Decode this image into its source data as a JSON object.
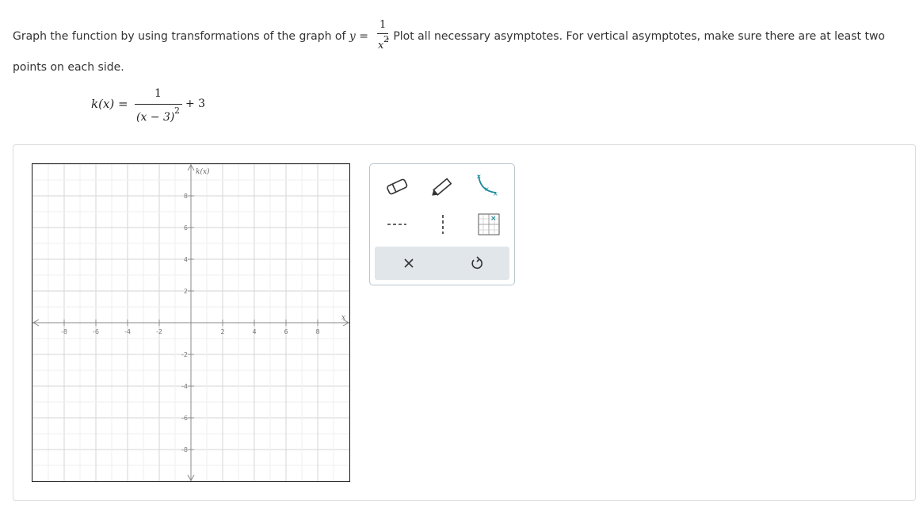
{
  "prompt": {
    "text_before": "Graph the function by using transformations of the graph of ",
    "y_var": "y",
    "equals": "=",
    "base_numerator": "1",
    "base_denominator": "x",
    "base_exponent": "2",
    "text_after": ". Plot all necessary asymptotes. For vertical asymptotes, make sure there are at least two",
    "text_line2": "points on each side."
  },
  "function": {
    "lhs": "k(x) =",
    "numerator": "1",
    "denominator": "(x − 3)",
    "exponent": "2",
    "shift": "+ 3"
  },
  "graph": {
    "y_axis_label": "k(x)",
    "x_axis_label": "x",
    "x_ticks": [
      "-8",
      "-6",
      "-4",
      "-2",
      "2",
      "4",
      "6",
      "8"
    ],
    "y_ticks": [
      "8",
      "6",
      "4",
      "2",
      "-2",
      "-4",
      "-6",
      "-8"
    ],
    "range": [
      -10,
      10
    ]
  },
  "toolbar": {
    "tools": [
      "eraser-icon",
      "pencil-icon",
      "curve-tool-icon",
      "horizontal-asymptote-icon",
      "vertical-asymptote-icon",
      "grid-points-icon"
    ],
    "actions": [
      "clear-icon",
      "undo-icon"
    ]
  },
  "colors": {
    "teal": "#1d8a99",
    "panel_border": "#dcdcdc",
    "action_bg": "#e1e6ea"
  }
}
